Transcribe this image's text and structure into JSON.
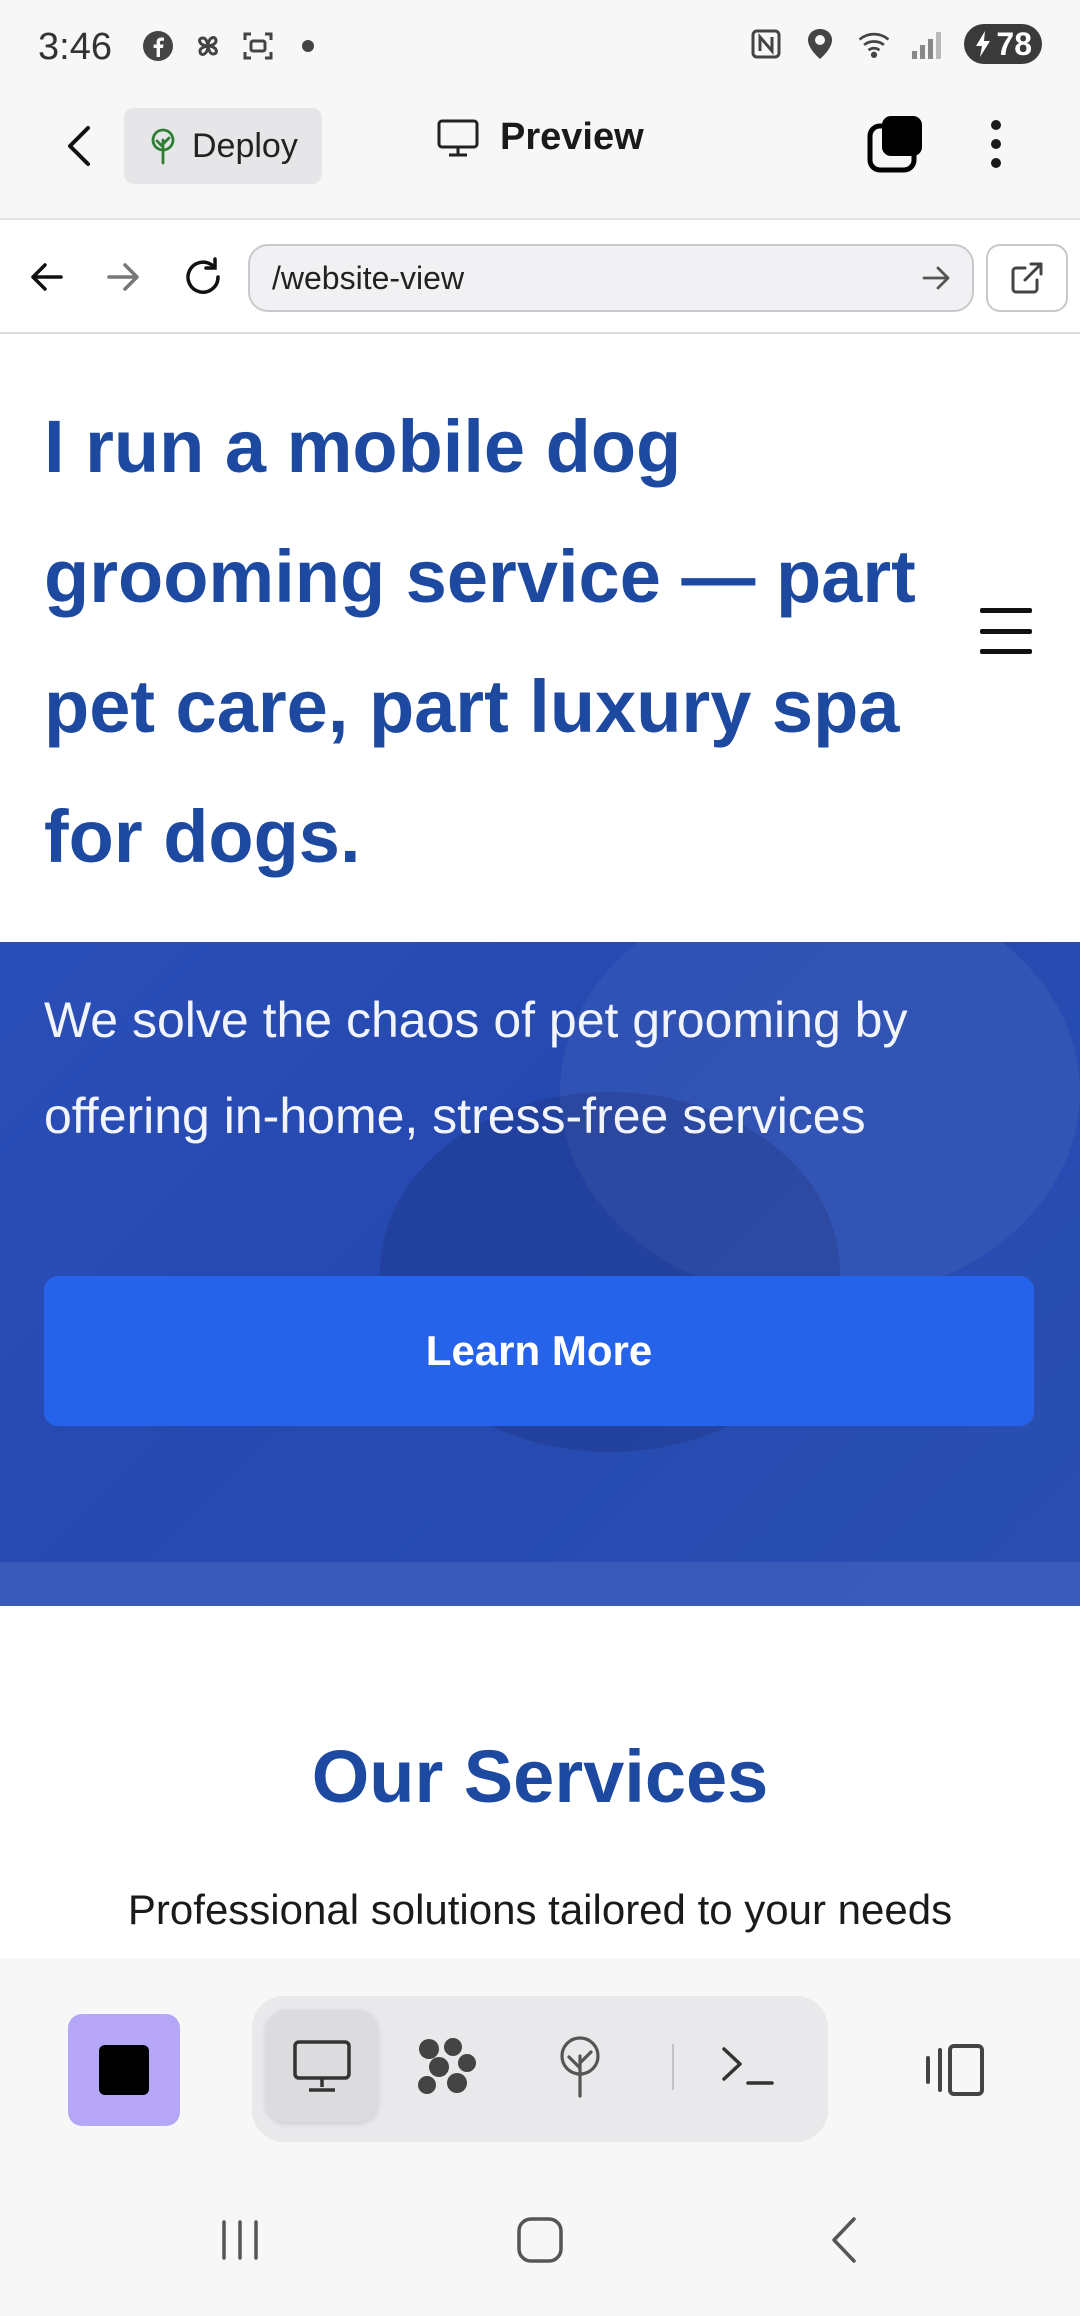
{
  "status_bar": {
    "time": "3:46",
    "battery": "78",
    "left_icons": [
      "facebook-icon",
      "pinwheel-icon",
      "screenshot-icon",
      "dot-icon"
    ],
    "right_icons": [
      "nfc-icon",
      "location-icon",
      "wifi-icon",
      "signal-icon",
      "battery-icon"
    ]
  },
  "app_header": {
    "deploy_label": "Deploy",
    "preview_label": "Preview"
  },
  "browser": {
    "url": "/website-view"
  },
  "page": {
    "hero_title": "I run a mobile dog grooming service — part pet care, part luxury spa for dogs.",
    "hero_subtitle": "We solve the chaos of pet grooming by offering in-home, stress-free services",
    "cta_label": "Learn More",
    "services_title": "Our Services",
    "services_subtitle": "Professional solutions tailored to your needs"
  },
  "toolbar": {
    "tools": [
      "desktop-preview",
      "components",
      "deploy",
      "terminal"
    ],
    "active_tool": "desktop-preview"
  },
  "colors": {
    "heading_blue": "#1d4aa0",
    "hero_band": "#2b4fb8",
    "cta_blue": "#2563eb",
    "stop_purple": "#b5a6f7"
  }
}
